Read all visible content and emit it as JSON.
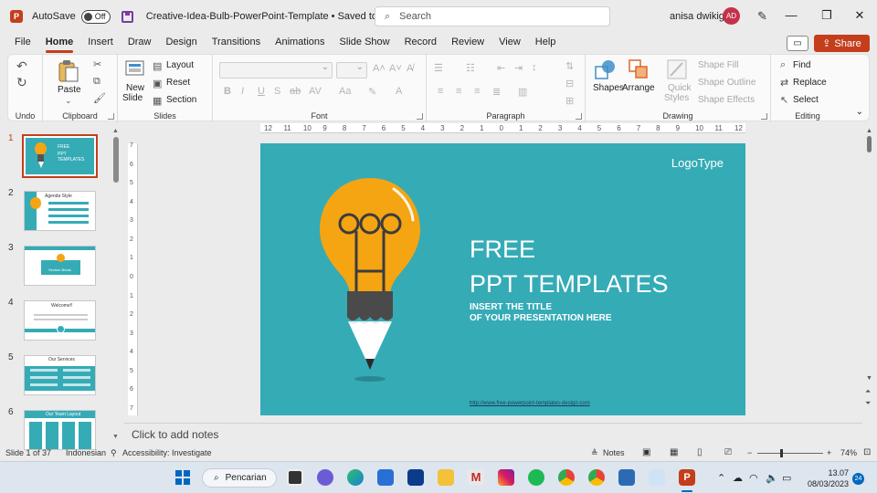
{
  "titlebar": {
    "app_icon_letter": "P",
    "autosave_label": "AutoSave",
    "autosave_state": "Off",
    "document_title": "Creative-Idea-Bulb-PowerPoint-Template • Saved to this PC",
    "search_placeholder": "Search",
    "user_name": "anisa dwikig",
    "user_initials": "AD"
  },
  "menu": {
    "tabs": [
      "File",
      "Home",
      "Insert",
      "Draw",
      "Design",
      "Transitions",
      "Animations",
      "Slide Show",
      "Record",
      "Review",
      "View",
      "Help"
    ],
    "active_tab": "Home",
    "share_label": "Share"
  },
  "ribbon": {
    "undo_group": "Undo",
    "clipboard": {
      "paste": "Paste",
      "label": "Clipboard"
    },
    "slides": {
      "new_slide_1": "New",
      "new_slide_2": "Slide",
      "layout": "Layout",
      "reset": "Reset",
      "section": "Section",
      "label": "Slides"
    },
    "font": {
      "label": "Font"
    },
    "paragraph": {
      "label": "Paragraph"
    },
    "drawing": {
      "shapes": "Shapes",
      "arrange": "Arrange",
      "quick_styles_1": "Quick",
      "quick_styles_2": "Styles",
      "shape_fill": "Shape Fill",
      "shape_outline": "Shape Outline",
      "shape_effects": "Shape Effects",
      "label": "Drawing"
    },
    "editing": {
      "find": "Find",
      "replace": "Replace",
      "select": "Select",
      "label": "Editing"
    }
  },
  "thumbnails": [
    {
      "num": "1",
      "title": "FREE",
      "sub": "PPT TEMPLATES"
    },
    {
      "num": "2",
      "title": "Agenda Style"
    },
    {
      "num": "3",
      "title": "Section Break"
    },
    {
      "num": "4",
      "title": "Welcome!!"
    },
    {
      "num": "5",
      "title": "Our Services"
    },
    {
      "num": "6",
      "title": "Our Team Layout"
    }
  ],
  "ruler": {
    "h_ticks": [
      "12",
      "11",
      "10",
      "9",
      "8",
      "7",
      "6",
      "5",
      "4",
      "3",
      "2",
      "1",
      "0",
      "1",
      "2",
      "3",
      "4",
      "5",
      "6",
      "7",
      "8",
      "9",
      "10",
      "11",
      "12"
    ],
    "v_ticks": [
      "7",
      "6",
      "5",
      "4",
      "3",
      "2",
      "1",
      "0",
      "1",
      "2",
      "3",
      "4",
      "5",
      "6",
      "7"
    ]
  },
  "slide": {
    "logo_type": "LogoType",
    "title_line1": "FREE",
    "title_line2": "PPT TEMPLATES",
    "subtitle_line1": "INSERT THE TITLE",
    "subtitle_line2": "OF YOUR PRESENTATION HERE",
    "footer_url": "http://www.free-powerpoint-templates-design.com",
    "background_color": "#35abb6",
    "bulb_color": "#f5a412"
  },
  "notes_placeholder": "Click to add notes",
  "status": {
    "slide_counter": "Slide 1 of 37",
    "language": "Indonesian",
    "accessibility": "Accessibility: Investigate",
    "notes": "Notes",
    "zoom": "74%"
  },
  "taskbar": {
    "search_label": "Pencarian",
    "time": "13.07",
    "date": "08/03/2023",
    "notification_count": "24"
  },
  "colors": {
    "accent": "#c43e1c"
  }
}
